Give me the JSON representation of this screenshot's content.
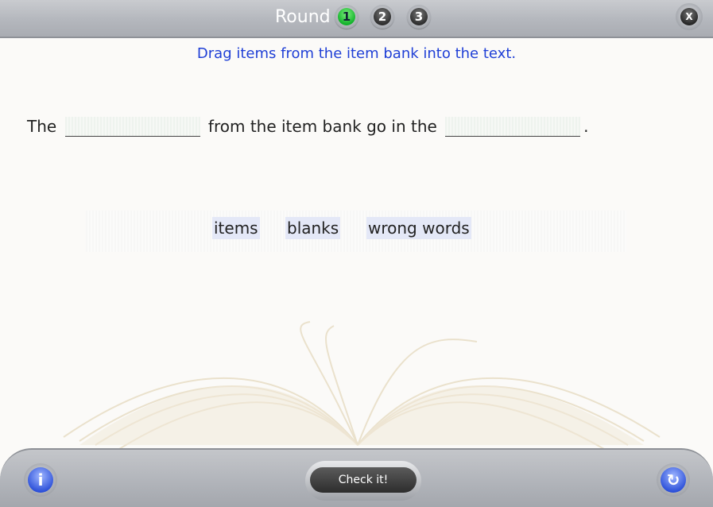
{
  "header": {
    "round_label": "Round",
    "rounds": [
      "1",
      "2",
      "3"
    ],
    "active_round": "1",
    "close_label": "X"
  },
  "instructions": "Drag items from the item bank into the text.",
  "sentence": {
    "part1": "The",
    "part2": "from the item bank go in the",
    "part3": "."
  },
  "item_bank": [
    "items",
    "blanks",
    "wrong words"
  ],
  "footer": {
    "check_label": "Check it!",
    "info_icon": "i",
    "reset_icon": "↻"
  },
  "colors": {
    "instructions": "#1f3fd6",
    "active_round": "#14b22c"
  }
}
